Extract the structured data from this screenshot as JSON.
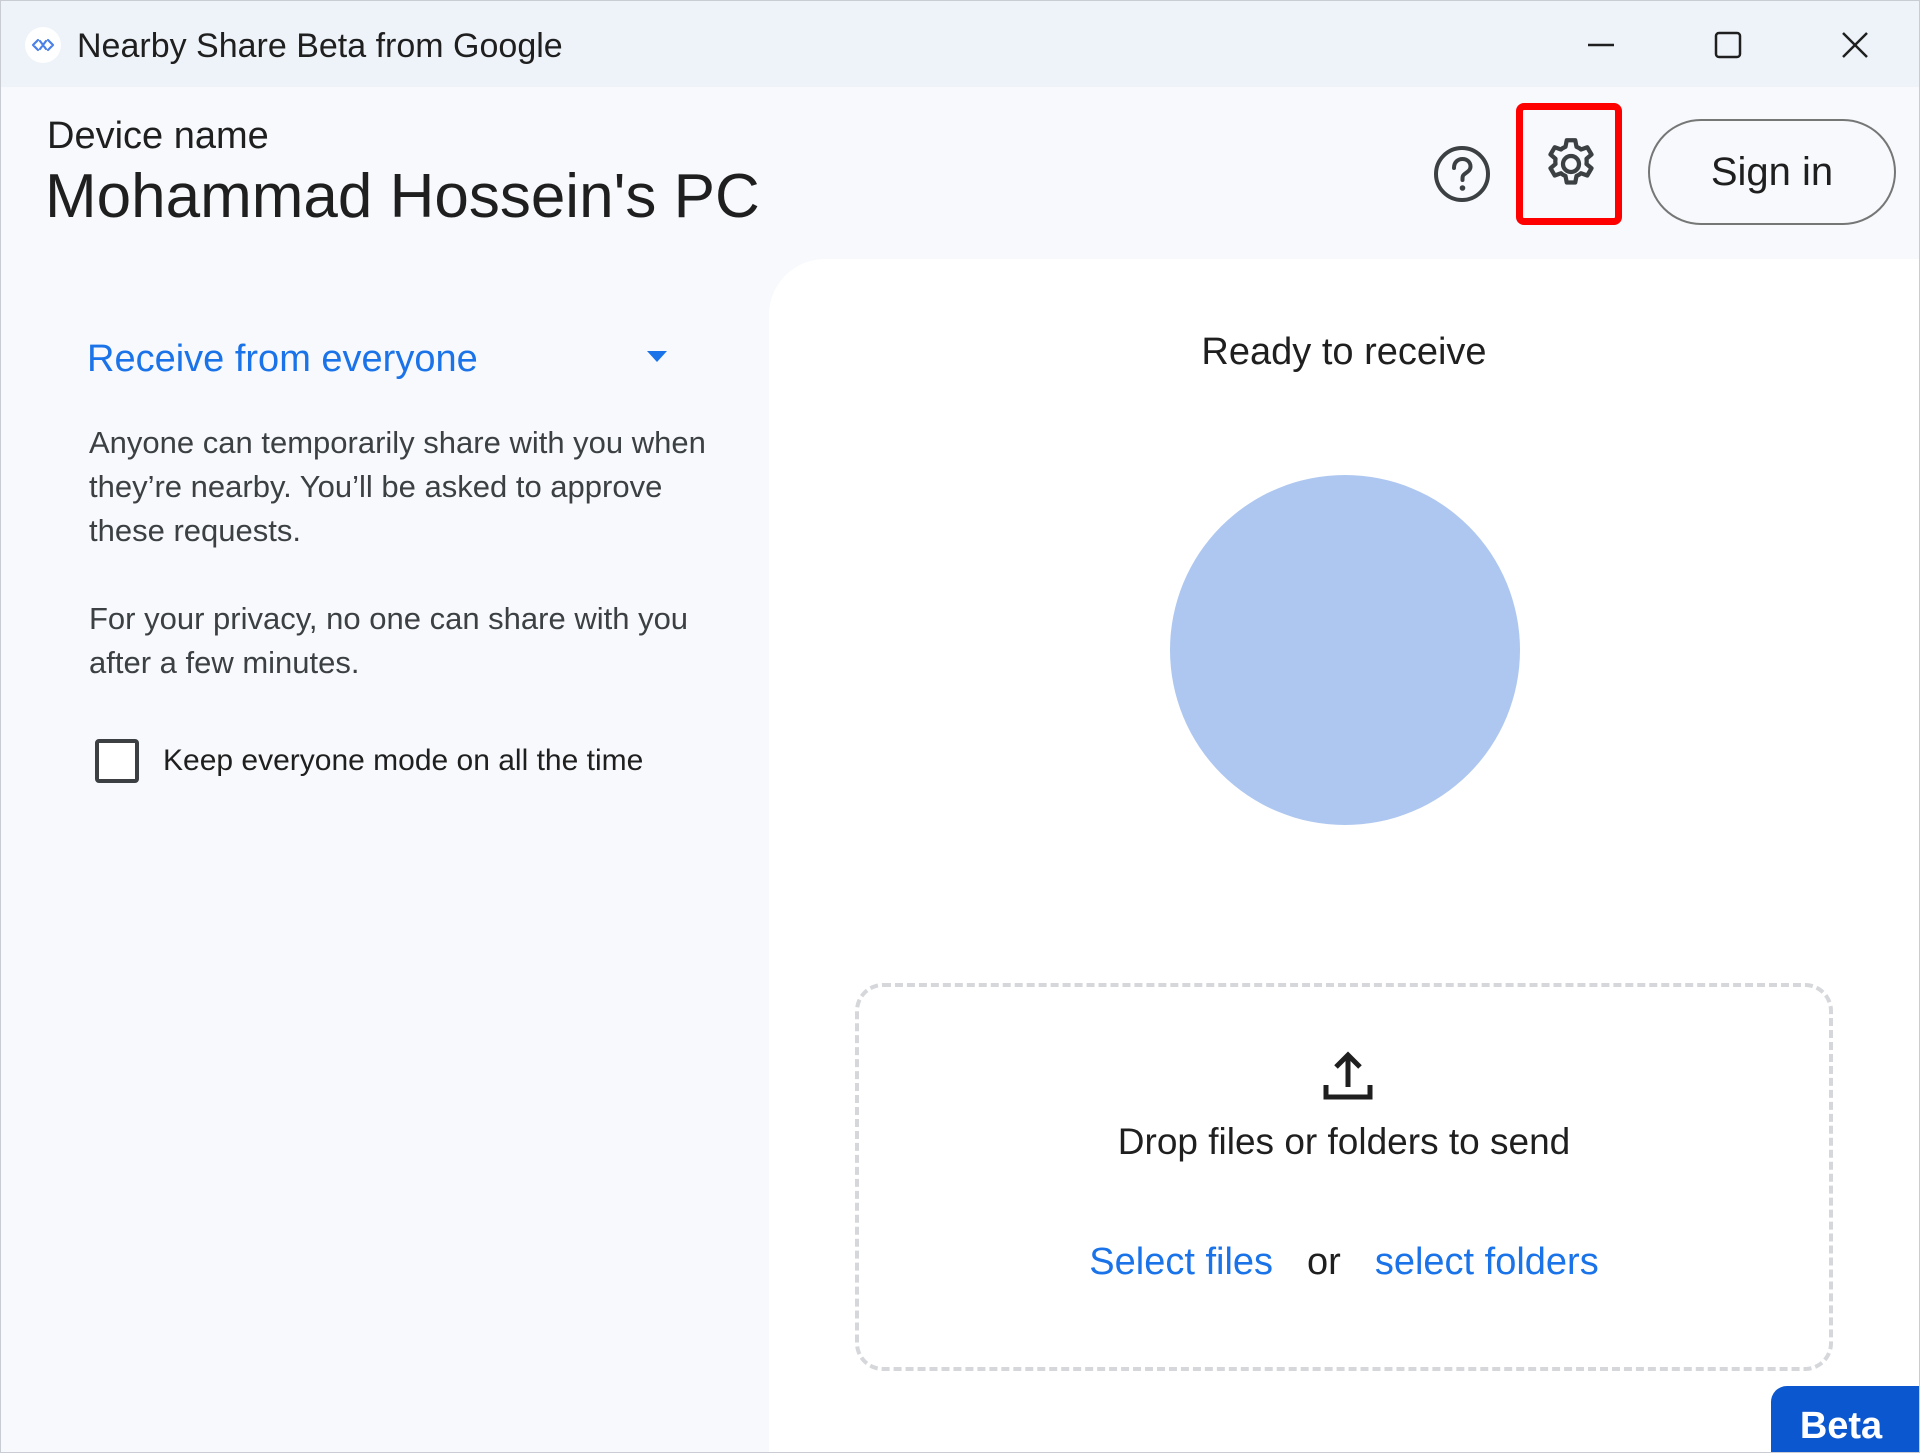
{
  "window": {
    "title": "Nearby Share Beta from Google",
    "icon": "nearby-share-icon",
    "controls": [
      "minimize-icon",
      "maximize-icon",
      "close-icon"
    ]
  },
  "header": {
    "device_label": "Device name",
    "device_name": "Mohammad Hossein's PC",
    "help_icon": "help-icon",
    "settings_icon": "gear-icon",
    "sign_in_label": "Sign in"
  },
  "visibility": {
    "selected": "Receive from everyone",
    "description_1": "Anyone can temporarily share with you when they’re nearby. You’ll be asked to approve these requests.",
    "description_2": "For your privacy, no one can share with you after a few minutes.",
    "keep_on_label": "Keep everyone mode on all the time",
    "keep_on_checked": false
  },
  "receive": {
    "status": "Ready to receive"
  },
  "send": {
    "drop_text": "Drop files or folders to send",
    "select_files": "Select files",
    "or_text": "or",
    "select_folders": "select folders"
  },
  "badge": {
    "label": "Beta"
  },
  "colors": {
    "accent": "#1a73e8",
    "circle": "#aec7f0",
    "highlight": "#ff0000",
    "badge": "#0b57d0"
  }
}
